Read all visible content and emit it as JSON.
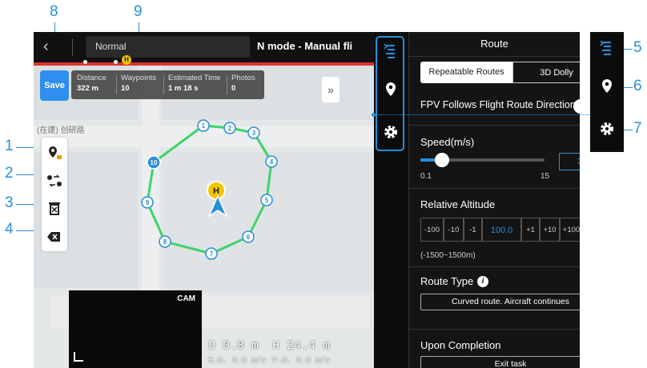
{
  "callouts": {
    "n1": "1",
    "n2": "2",
    "n3": "3",
    "n4": "4",
    "n5": "5",
    "n6": "6",
    "n7": "7",
    "n8": "8",
    "n9": "9"
  },
  "topbar": {
    "mode": "Normal",
    "title": "N mode - Manual fli"
  },
  "map": {
    "street_label": "(在建) 创研路",
    "home_marker": "H"
  },
  "save_label": "Save",
  "stats": [
    {
      "label": "Distance",
      "value": "322 m"
    },
    {
      "label": "Waypoints",
      "value": "10"
    },
    {
      "label": "Estimated Time",
      "value": "1 m 18 s"
    },
    {
      "label": "Photos",
      "value": "0"
    }
  ],
  "waypoints": [
    "1",
    "2",
    "3",
    "4",
    "5",
    "6",
    "7",
    "8",
    "9",
    "10"
  ],
  "cam_label": "CAM",
  "telemetry": {
    "d": "D 0.8 m",
    "h": "H 24.4 m",
    "hs": "H.S. 0.0 m/s",
    "vs": "V.S. 0.0 m/s"
  },
  "panel": {
    "title": "Route",
    "tab_repeatable": "Repeatable Routes",
    "tab_dolly": "3D Dolly",
    "fpv_label": "FPV Follows Flight Route Direction",
    "speed_label": "Speed(m/s)",
    "speed_value": "3",
    "speed_min": "0.1",
    "speed_max": "15",
    "alt_label": "Relative Altitude",
    "alt_buttons": [
      "-100",
      "-10",
      "-1",
      "100.0",
      "+1",
      "+10",
      "+100"
    ],
    "alt_range": "(-1500~1500m)",
    "route_type_label": "Route Type",
    "route_type_value": "Curved route. Aircraft continues",
    "completion_label": "Upon Completion",
    "completion_value": "Exit task"
  },
  "colors": {
    "accent": "#2a8fd8",
    "route": "#3fd36a",
    "save": "#2e8ff0",
    "home": "#f5c400"
  }
}
